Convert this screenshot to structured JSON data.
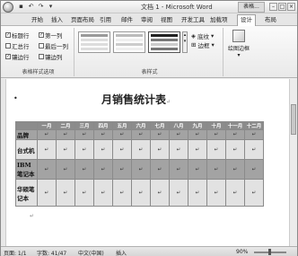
{
  "window": {
    "title": "文档 1 - Microsoft Word",
    "context_tab": "表格..."
  },
  "ribbon_tabs": [
    {
      "label": "开始"
    },
    {
      "label": "插入"
    },
    {
      "label": "页面布局"
    },
    {
      "label": "引用"
    },
    {
      "label": "邮件"
    },
    {
      "label": "审阅"
    },
    {
      "label": "视图"
    },
    {
      "label": "开发工具"
    },
    {
      "label": "加载项"
    },
    {
      "label": "设计",
      "active": true
    },
    {
      "label": "布局"
    }
  ],
  "style_options": {
    "header_row": "标题行",
    "first_column": "第一列",
    "total_row": "汇总行",
    "last_column": "最后一列",
    "banded_rows": "镶边行",
    "banded_columns": "镶边列",
    "group_label": "表格样式选项",
    "checked": {
      "header_row": true,
      "first_column": true,
      "total_row": false,
      "last_column": false,
      "banded_rows": true,
      "banded_columns": false
    }
  },
  "table_styles": {
    "group_label": "表样式",
    "shading": "底纹",
    "borders": "边框"
  },
  "draw_borders": {
    "label": "绘图边框"
  },
  "document": {
    "title": "月销售统计表",
    "months": [
      "一月",
      "二月",
      "三月",
      "四月",
      "五月",
      "六月",
      "七月",
      "八月",
      "九月",
      "十月",
      "十一月",
      "十二月"
    ],
    "rows": [
      {
        "label": "品牌"
      },
      {
        "label": "台式机"
      },
      {
        "label": "IBM笔记本"
      },
      {
        "label": "华硕笔记本"
      }
    ]
  },
  "statusbar": {
    "page": "页面: 1/1",
    "words": "字数: 41/47",
    "language": "中文(中国)",
    "mode": "插入",
    "zoom": "90%"
  },
  "colors": {
    "header_band": "#8c8c8c",
    "dark_band": "#a3a3a3",
    "light_band": "#e2e2e2"
  }
}
